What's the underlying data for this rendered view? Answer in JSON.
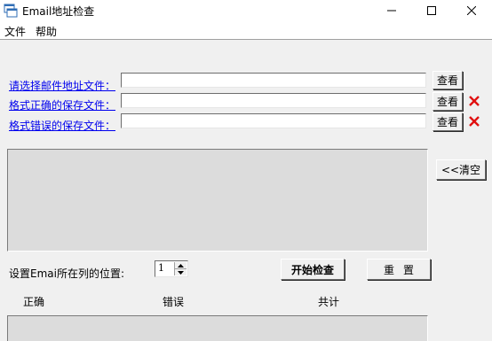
{
  "window": {
    "title": "Email地址检查",
    "controls": {
      "minimize": "—",
      "maximize": "☐",
      "close": "✕"
    }
  },
  "menu": {
    "items": [
      {
        "label": "文件"
      },
      {
        "label": "帮助"
      }
    ]
  },
  "files": {
    "rows": [
      {
        "label": "请选择邮件地址文件：",
        "value": "",
        "browse_label": "查看",
        "has_error": false
      },
      {
        "label": "格式正确的保存文件：",
        "value": "",
        "browse_label": "查看",
        "has_error": true
      },
      {
        "label": "格式错误的保存文件：",
        "value": "",
        "browse_label": "查看",
        "has_error": true
      }
    ],
    "error_mark": "X",
    "error_color": "#e01010"
  },
  "log": {
    "content": "",
    "clear_label": "<<清空"
  },
  "settings": {
    "column_label": "设置Emai所在列的位置:",
    "column_value": "1"
  },
  "actions": {
    "start_label": "开始检查",
    "reset_label": "重置"
  },
  "results": {
    "headers": {
      "correct": "正确",
      "wrong": "错误",
      "total": "共计"
    }
  },
  "colors": {
    "link": "#0000ee",
    "window_bg": "#f0f0f0",
    "panel_bg": "#dcdcdc"
  }
}
